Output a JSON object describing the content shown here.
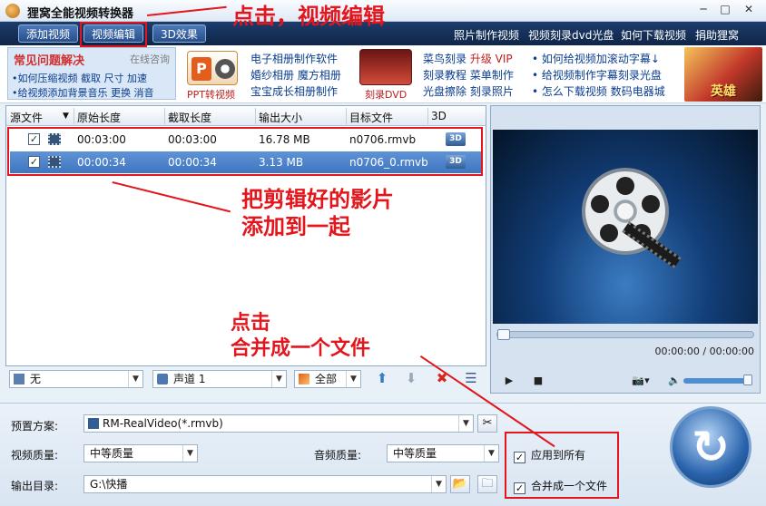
{
  "app": {
    "title": "狸窝全能视频转换器"
  },
  "window_controls": {
    "minimize": "─",
    "maximize": "□",
    "close": "✕"
  },
  "toolbar": {
    "buttons": [
      "添加视频",
      "视频编辑",
      "3D效果"
    ],
    "links": [
      "照片制作视频",
      "视频刻录dvd光盘",
      "如何下载视频",
      "捐助狸窝"
    ]
  },
  "faq": {
    "title": "常见问题解决",
    "online": "在线咨询",
    "lines": [
      "•如何压缩视频 截取 尺寸 加速",
      "•给视频添加背景音乐 更换 消音"
    ]
  },
  "promo": {
    "ppt_label": "PPT转视频",
    "album_links": [
      "电子相册制作软件",
      "婚纱相册 魔方相册",
      "宝宝成长相册制作"
    ],
    "dvd_label": "刻录DVD",
    "burn_links": [
      {
        "text": "菜鸟刻录 ",
        "vip": "升级 VIP"
      },
      {
        "text": "刻录教程 菜单制作",
        "vip": ""
      },
      {
        "text": "光盘擦除 刻录照片",
        "vip": ""
      }
    ],
    "help_links": [
      "• 如何给视频加滚动字幕↓",
      "• 给视频制作字幕刻录光盘",
      "• 怎么下载视频 数码电器城"
    ],
    "avatar_text": "英雄"
  },
  "table": {
    "columns": [
      "源文件",
      "原始长度",
      "截取长度",
      "输出大小",
      "目标文件",
      "3D"
    ],
    "rows": [
      {
        "checked": "✓",
        "original": "00:03:00",
        "clip": "00:03:00",
        "size": "16.78 MB",
        "target": "n0706.rmvb",
        "badge": "3D"
      },
      {
        "checked": "✓",
        "original": "00:00:34",
        "clip": "00:00:34",
        "size": "3.13 MB",
        "target": "n0706_0.rmvb",
        "badge": "3D"
      }
    ]
  },
  "annotations": {
    "click_edit": "点击，视频编辑",
    "merge_clips_1": "把剪辑好的影片",
    "merge_clips_2": "添加到一起",
    "click_merge_1": "点击",
    "click_merge_2": "合并成一个文件"
  },
  "controls": {
    "subtitle": "无",
    "audio_track": "声道 1",
    "scope": "全部"
  },
  "preview": {
    "timecode": "00:00:00 / 00:00:00",
    "seek": 0.0,
    "volume": 1.0
  },
  "settings": {
    "preset_label": "预置方案:",
    "preset_value": "RM-RealVideo(*.rmvb)",
    "video_quality_label": "视频质量:",
    "video_quality_value": "中等质量",
    "audio_quality_label": "音频质量:",
    "audio_quality_value": "中等质量",
    "output_label": "输出目录:",
    "output_value": "G:\\快播",
    "apply_all": "应用到所有",
    "merge_one": "合并成一个文件"
  },
  "colors": {
    "annotation": "#e2161c",
    "selected_row": "#3f76c1",
    "toolbar": "#1d3c6b"
  }
}
